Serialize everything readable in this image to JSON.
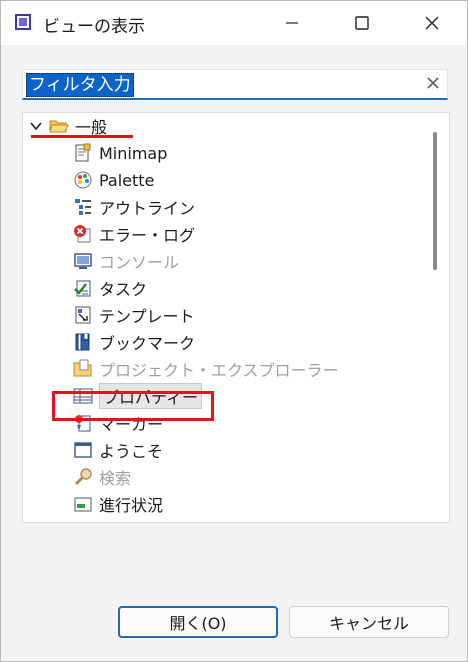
{
  "window": {
    "title": "ビューの表示"
  },
  "filter": {
    "value": "フィルタ入力"
  },
  "tree": {
    "group_label": "一般",
    "items": [
      {
        "label": "Minimap",
        "icon": "minimap-icon",
        "disabled": false
      },
      {
        "label": "Palette",
        "icon": "palette-icon",
        "disabled": false
      },
      {
        "label": "アウトライン",
        "icon": "outline-icon",
        "disabled": false
      },
      {
        "label": "エラー・ログ",
        "icon": "error-log-icon",
        "disabled": false
      },
      {
        "label": "コンソール",
        "icon": "console-icon",
        "disabled": true
      },
      {
        "label": "タスク",
        "icon": "tasks-icon",
        "disabled": false
      },
      {
        "label": "テンプレート",
        "icon": "templates-icon",
        "disabled": false
      },
      {
        "label": "ブックマーク",
        "icon": "bookmarks-icon",
        "disabled": false
      },
      {
        "label": "プロジェクト・エクスプローラー",
        "icon": "project-explorer-icon",
        "disabled": true
      },
      {
        "label": "プロパティー",
        "icon": "properties-icon",
        "disabled": false,
        "selected": true
      },
      {
        "label": "マーカー",
        "icon": "markers-icon",
        "disabled": false
      },
      {
        "label": "ようこそ",
        "icon": "welcome-icon",
        "disabled": false
      },
      {
        "label": "検索",
        "icon": "search-icon",
        "disabled": true
      },
      {
        "label": "進行状況",
        "icon": "progress-icon",
        "disabled": false
      }
    ]
  },
  "buttons": {
    "open": "開く(O)",
    "cancel": "キャンセル"
  },
  "colors": {
    "accent": "#0a64c9",
    "highlight": "#e0141c"
  }
}
